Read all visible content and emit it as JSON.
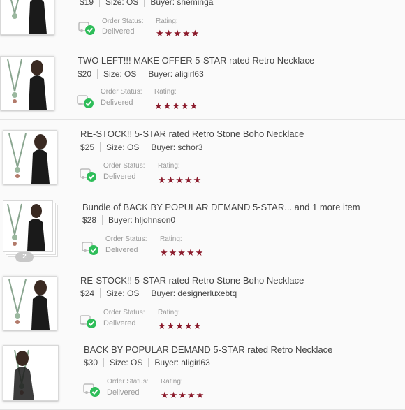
{
  "colors": {
    "star": "#8b1a2b",
    "delivered_check": "#2ebd59",
    "label_gray": "#9a9a9a"
  },
  "labels": {
    "order_status": "Order Status:",
    "rating": "Rating:",
    "stars": "★★★★★"
  },
  "orders": [
    {
      "title": "",
      "price": "$19",
      "size": "Size: OS",
      "buyer": "Buyer: sheminga",
      "status": "Delivered",
      "rating": 5
    },
    {
      "title": "TWO LEFT!!! MAKE OFFER 5-STAR rated Retro Necklace",
      "price": "$20",
      "size": "Size: OS",
      "buyer": "Buyer: aligirl63",
      "status": "Delivered",
      "rating": 5
    },
    {
      "title": "RE-STOCK!! 5-STAR rated Retro Stone Boho Necklace",
      "price": "$25",
      "size": "Size: OS",
      "buyer": "Buyer: schor3",
      "status": "Delivered",
      "rating": 5
    },
    {
      "title": "Bundle of BACK BY POPULAR DEMAND 5-STAR... and 1 more item",
      "price": "$28",
      "buyer": "Buyer: hljohnson0",
      "item_count": "2",
      "status": "Delivered",
      "rating": 5
    },
    {
      "title": "RE-STOCK!! 5-STAR rated Retro Stone Boho Necklace",
      "price": "$24",
      "size": "Size: OS",
      "buyer": "Buyer: designerluxebtq",
      "status": "Delivered",
      "rating": 5
    },
    {
      "title": "BACK BY POPULAR DEMAND 5-STAR rated Retro Necklace",
      "price": "$30",
      "size": "Size: OS",
      "buyer": "Buyer: aligirl63",
      "status": "Delivered",
      "rating": 5
    }
  ]
}
